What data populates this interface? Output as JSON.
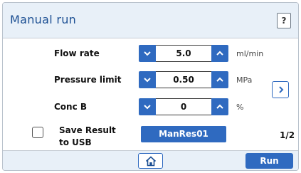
{
  "header": {
    "title": "Manual  run",
    "help_label": "?"
  },
  "rows": [
    {
      "label": "Flow rate",
      "value": "5.0",
      "unit": "ml/min"
    },
    {
      "label": "Pressure limit",
      "value": "0.50",
      "unit": "MPa"
    },
    {
      "label": "Conc B",
      "value": "0",
      "unit": "%"
    }
  ],
  "save_result": {
    "label_line1": "Save Result",
    "label_line2": "to USB",
    "checked": false
  },
  "result_name": "ManRes01",
  "page_indicator": "1/2",
  "footer": {
    "run_label": "Run"
  },
  "colors": {
    "accent": "#2f6ac0",
    "title": "#1c4f93",
    "bar_bg": "#e8f0f8"
  },
  "icons": [
    "help-icon",
    "chevron-down-icon",
    "chevron-up-icon",
    "chevron-right-icon",
    "home-icon"
  ]
}
